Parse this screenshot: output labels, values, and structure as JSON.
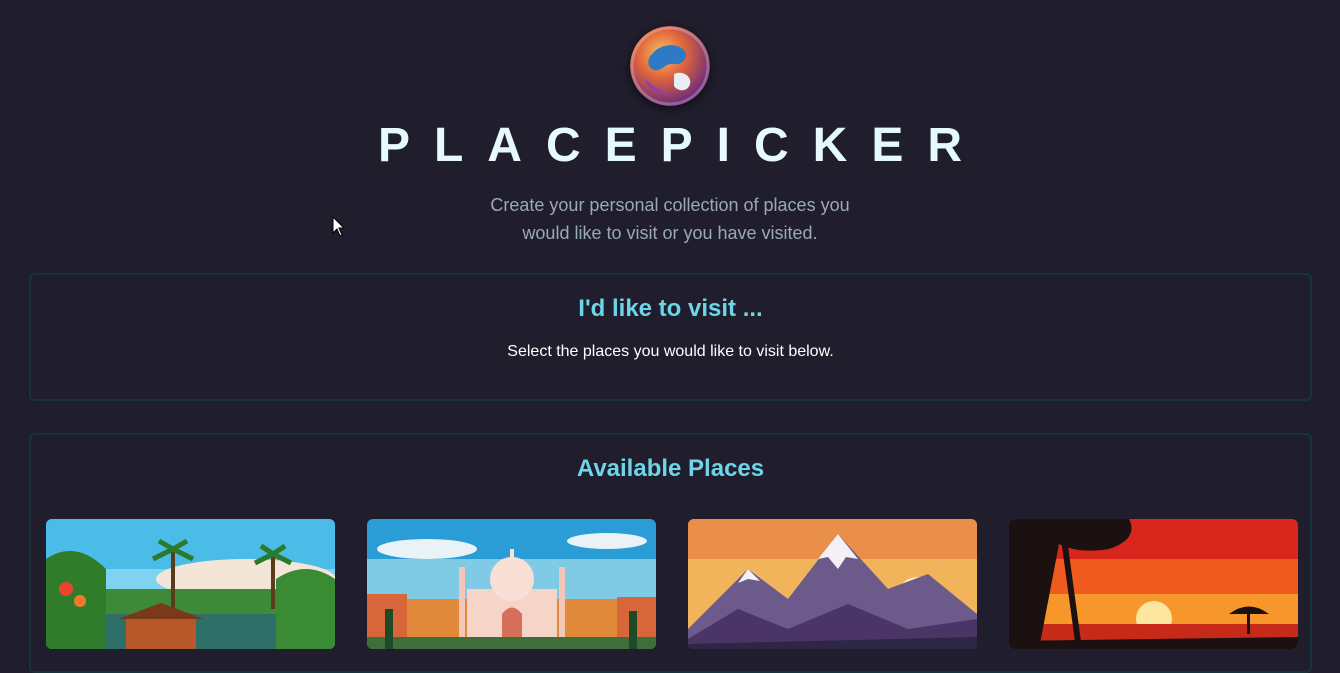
{
  "app": {
    "title": "PLACEPICKER",
    "tagline": "Create your personal collection of places you would like to visit or you have visited."
  },
  "visit_section": {
    "heading": "I'd like to visit ...",
    "fallback_text": "Select the places you would like to visit below."
  },
  "available_section": {
    "heading": "Available Places",
    "places": [
      {
        "image": "tropical-forest-hut"
      },
      {
        "image": "taj-mahal"
      },
      {
        "image": "snowy-mountains"
      },
      {
        "image": "african-sunset"
      }
    ]
  },
  "colors": {
    "background": "#201d2c",
    "accent": "#6ed5e8",
    "title": "#e6f9fc",
    "border": "#16333b"
  }
}
